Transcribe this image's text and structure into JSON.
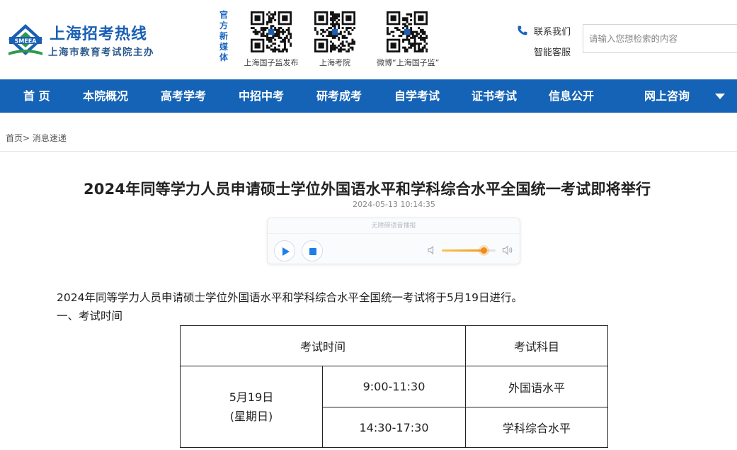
{
  "site": {
    "title": "上海招考热线",
    "subtitle": "上海市教育考试院主办",
    "logo_text": "SMEEA",
    "media_label": "官方新媒体",
    "qr_codes": [
      {
        "caption": "上海国子监发布"
      },
      {
        "caption": "上海考院"
      },
      {
        "caption": "微博“上海国子监”"
      }
    ],
    "contact": {
      "line1": "联系我们",
      "line2": "智能客服"
    },
    "search": {
      "placeholder": "请输入您想检索的内容"
    },
    "colors": {
      "nav": "#1563b6",
      "brand": "#1a5fb4",
      "accent": "#f28c15"
    }
  },
  "nav": {
    "items": [
      "首 页",
      "本院概况",
      "高考学考",
      "中招中考",
      "研考成考",
      "自学考试",
      "证书考试",
      "信息公开",
      "网上咨询"
    ]
  },
  "breadcrumb": {
    "home": "首页",
    "sep": ">",
    "current": "消息速递"
  },
  "article": {
    "title": "2024年同等学力人员申请硕士学位外国语水平和学科综合水平全国统一考试即将举行",
    "date": "2024-05-13 10:14:35",
    "player": {
      "label": "无障碍语音播报",
      "volume": 0.78
    },
    "lead": "2024年同等学力人员申请硕士学位外国语水平和学科综合水平全国统一考试将于5月19日进行。",
    "section1": "一、考试时间",
    "table": {
      "headers": [
        "考试时间",
        "考试科目"
      ],
      "date": "5月19日",
      "weekday": "(星期日)",
      "rows": [
        {
          "time": "9:00-11:30",
          "subject": "外国语水平"
        },
        {
          "time": "14:30-17:30",
          "subject": "学科综合水平"
        }
      ]
    }
  }
}
